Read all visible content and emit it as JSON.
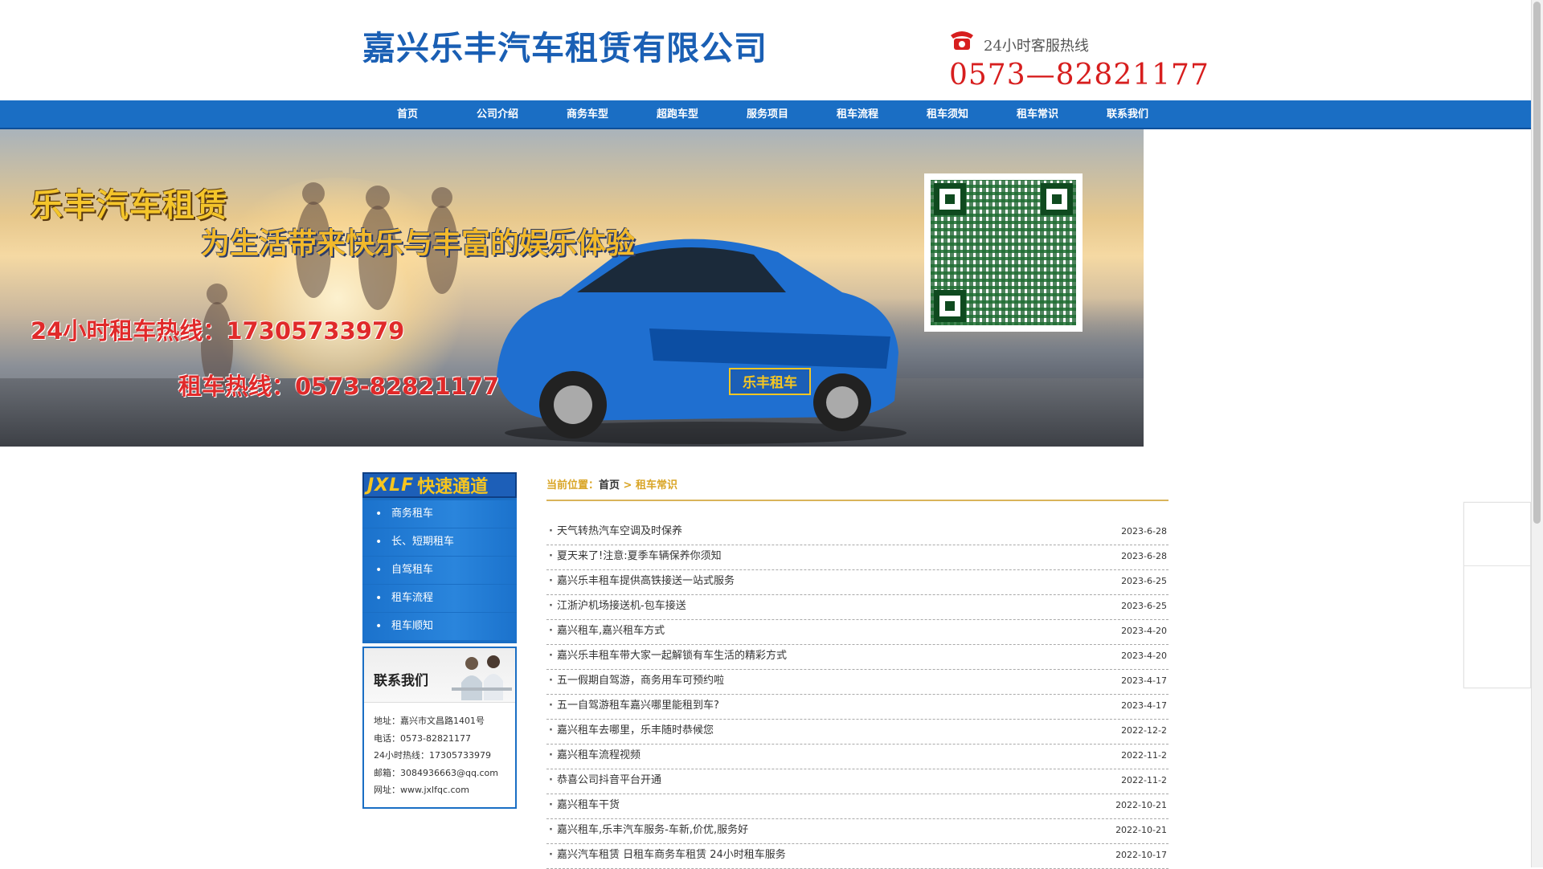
{
  "header": {
    "logo": "嘉兴乐丰汽车租赁有限公司",
    "hotline_label": "24小时客服热线",
    "hotline_number": "0573—82821177"
  },
  "nav": [
    "首页",
    "公司介绍",
    "商务车型",
    "超跑车型",
    "服务项目",
    "租车流程",
    "租车须知",
    "租车常识",
    "联系我们"
  ],
  "banner": {
    "title": "乐丰汽车租赁",
    "slogan": "为生活带来快乐与丰富的娱乐体验",
    "hotline24": "24小时租车热线：17305733979",
    "hotline": "租车热线：0573-82821177",
    "plate": "乐丰租车"
  },
  "sidebar": {
    "quick_title_en": "JXLF",
    "quick_title_cn": "快速通道",
    "quick_items": [
      "商务租车",
      "长、短期租车",
      "自驾租车",
      "租车流程",
      "租车顺知"
    ],
    "contact_title": "联系我们",
    "contact_lines": [
      "地址：嘉兴市文昌路1401号",
      "电话：0573-82821177",
      "24小时热线：17305733979",
      "邮箱：3084936663@qq.com",
      "网址：www.jxlfqc.com"
    ]
  },
  "breadcrumb": {
    "label": "当前位置：",
    "home": "首页",
    "sep": " > ",
    "current": "租车常识"
  },
  "news": [
    {
      "title": "天气转热汽车空调及时保养",
      "date": "2023-6-28"
    },
    {
      "title": "夏天来了!注意:夏季车辆保养你须知",
      "date": "2023-6-28"
    },
    {
      "title": "嘉兴乐丰租车提供高铁接送一站式服务",
      "date": "2023-6-25"
    },
    {
      "title": "江浙沪机场接送机-包车接送",
      "date": "2023-6-25"
    },
    {
      "title": "嘉兴租车,嘉兴租车方式",
      "date": "2023-4-20"
    },
    {
      "title": "嘉兴乐丰租车带大家一起解锁有车生活的精彩方式",
      "date": "2023-4-20"
    },
    {
      "title": "五一假期自驾游，商务用车可预约啦",
      "date": "2023-4-17"
    },
    {
      "title": "五一自驾游租车嘉兴哪里能租到车?",
      "date": "2023-4-17"
    },
    {
      "title": "嘉兴租车去哪里，乐丰随时恭候您",
      "date": "2022-12-2"
    },
    {
      "title": "嘉兴租车流程视频",
      "date": "2022-11-2"
    },
    {
      "title": "恭喜公司抖音平台开通",
      "date": "2022-11-2"
    },
    {
      "title": "嘉兴租车干货",
      "date": "2022-10-21"
    },
    {
      "title": "嘉兴租车,乐丰汽车服务-车新,价优,服务好",
      "date": "2022-10-21"
    },
    {
      "title": "嘉兴汽车租赁 日租车商务车租赁 24小时租车服务",
      "date": "2022-10-17"
    }
  ]
}
